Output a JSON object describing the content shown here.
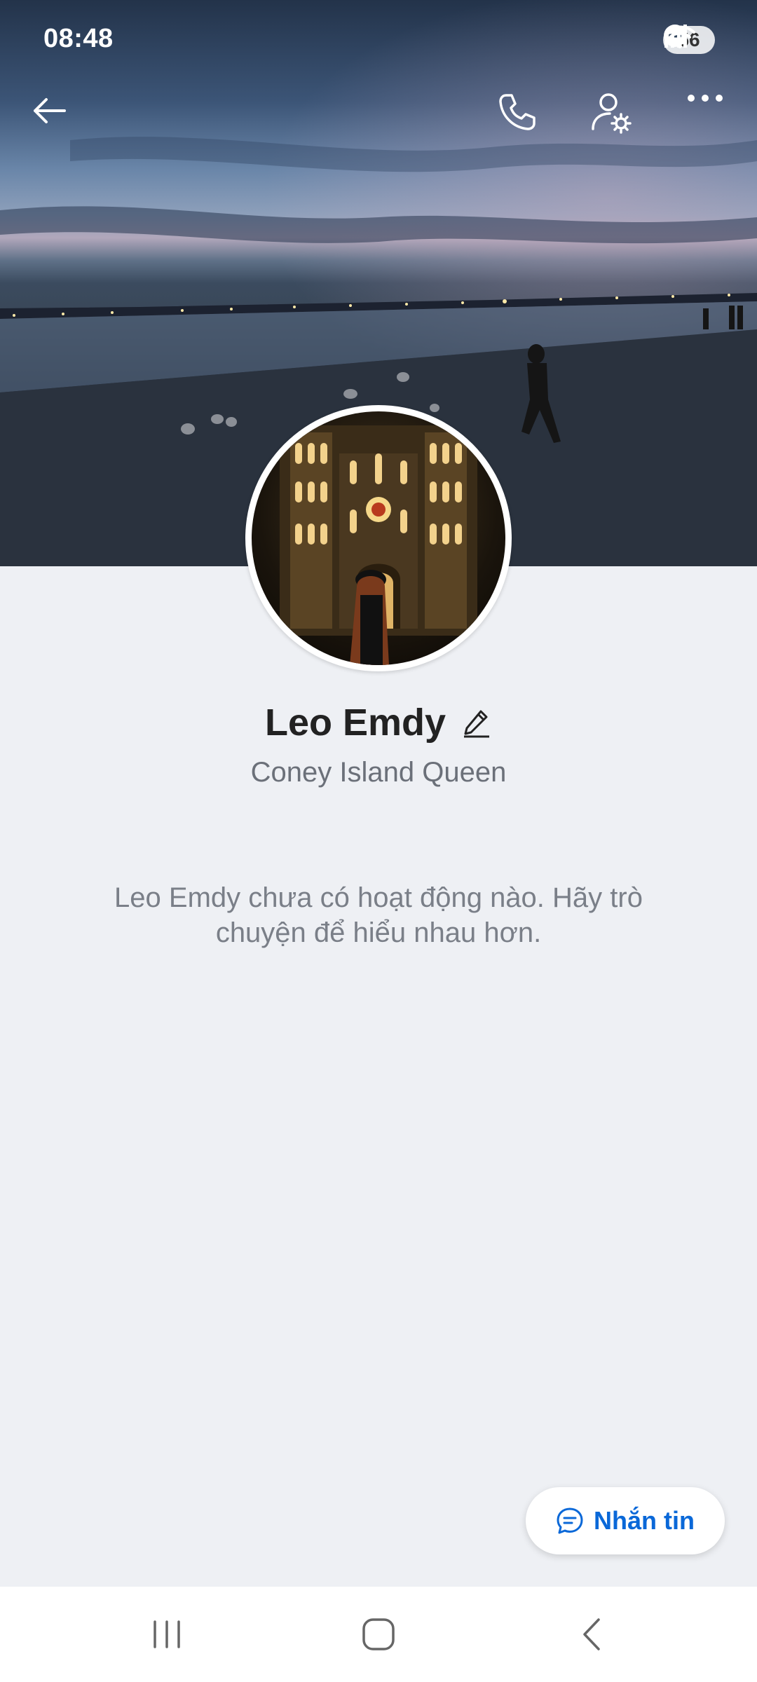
{
  "status_bar": {
    "time": "08:48",
    "battery": "56",
    "icons": [
      "do-not-disturb-icon",
      "wifi-icon",
      "signal-icon",
      "battery-icon"
    ]
  },
  "topbar": {
    "icons": [
      "back-arrow-icon",
      "phone-icon",
      "user-settings-icon",
      "more-icon"
    ]
  },
  "profile": {
    "name": "Leo Emdy",
    "subtitle": "Coney Island Queen",
    "empty_message": "Leo Emdy chưa có hoạt động nào. Hãy trò chuyện để hiểu nhau hơn."
  },
  "message_button": {
    "label": "Nhắn tin"
  },
  "navbar": {
    "icons": [
      "recent-apps-icon",
      "home-icon",
      "back-icon"
    ]
  },
  "colors": {
    "accent": "#0a68d8",
    "background": "#eef0f4"
  }
}
